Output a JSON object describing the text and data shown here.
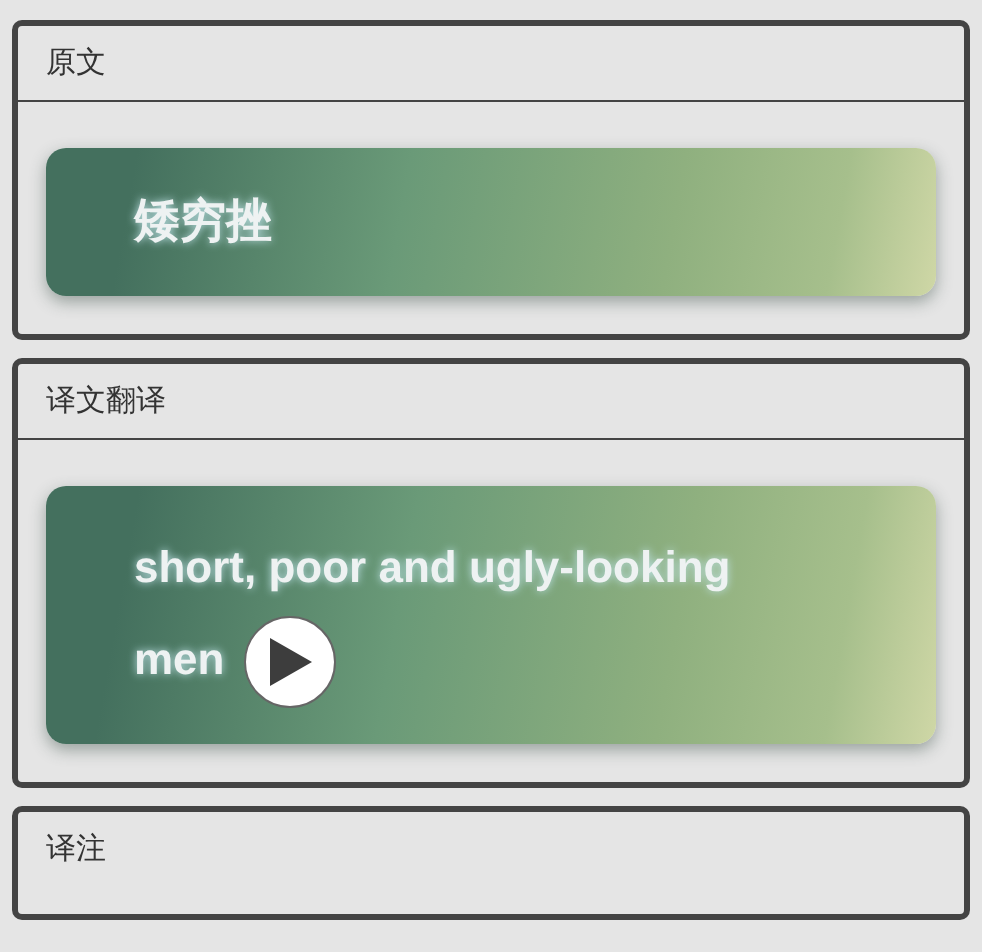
{
  "sections": [
    {
      "title": "原文",
      "card": {
        "text": "矮穷挫"
      }
    },
    {
      "title": "译文翻译",
      "card": {
        "text": "short, poor and ugly-looking men",
        "audio": true
      }
    },
    {
      "title": "译注"
    }
  ]
}
